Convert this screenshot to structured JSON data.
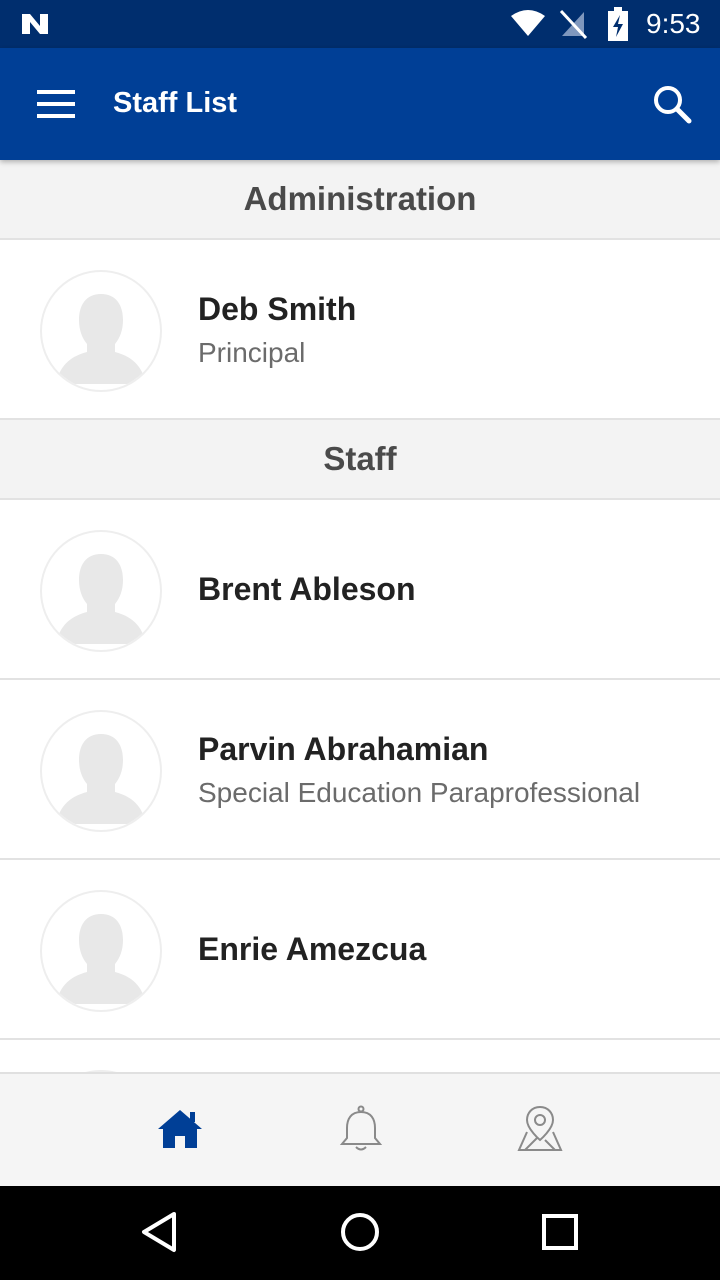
{
  "status_bar": {
    "time": "9:53",
    "icons": [
      "notification-n-icon",
      "wifi-icon",
      "no-signal-icon",
      "battery-charging-icon"
    ]
  },
  "app_bar": {
    "title": "Staff List",
    "menu_icon": "hamburger-menu-icon",
    "search_icon": "search-icon",
    "background": "#003f96"
  },
  "sections": [
    {
      "title": "Administration",
      "people": [
        {
          "name": "Deb Smith",
          "role": "Principal"
        }
      ]
    },
    {
      "title": "Staff",
      "people": [
        {
          "name": "Brent Ableson",
          "role": ""
        },
        {
          "name": "Parvin Abrahamian",
          "role": "Special Education Paraprofessional"
        },
        {
          "name": "Enrie Amezcua",
          "role": ""
        }
      ]
    }
  ],
  "bottom_nav": {
    "items": [
      {
        "icon": "home-icon",
        "active": true
      },
      {
        "icon": "bell-icon",
        "active": false
      },
      {
        "icon": "map-pin-icon",
        "active": false
      }
    ],
    "active_color": "#003f96",
    "inactive_color": "#8a8a8a"
  },
  "system_nav": {
    "items": [
      "back-icon",
      "home-circle-icon",
      "recents-icon"
    ]
  }
}
